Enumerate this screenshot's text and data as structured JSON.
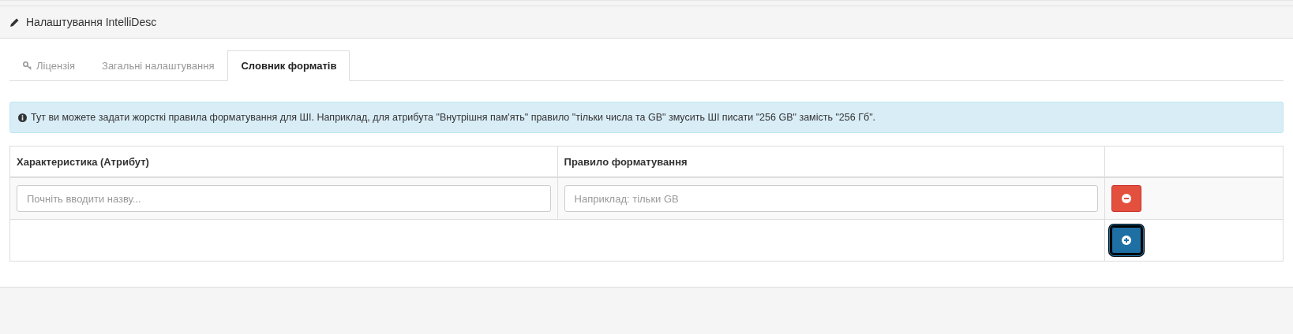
{
  "panel": {
    "title": "Налаштування IntelliDesc"
  },
  "tabs": [
    {
      "label": "Ліцензія",
      "selected": false,
      "kind": "icon"
    },
    {
      "label": "Загальні налаштування",
      "selected": false,
      "kind": "text"
    },
    {
      "label": "Словник форматів",
      "selected": true,
      "kind": "text"
    }
  ],
  "alert": {
    "text": "Тут ви можете задати жорсткі правила форматування для ШІ. Наприклад, для атрибута \"Внутрішня пам'ять\" правило \"тільки числа та GB\" змусить ШІ писати \"256 GB\" замість \"256 Гб\"."
  },
  "table": {
    "columns": [
      "Характеристика (Атрибут)",
      "Правило форматування"
    ],
    "rows": [
      {
        "attribute_placeholder": "Почніть вводити назву...",
        "rule_placeholder": "Наприклад: тільки GB"
      }
    ],
    "add_button": {
      "focused": true
    }
  }
}
